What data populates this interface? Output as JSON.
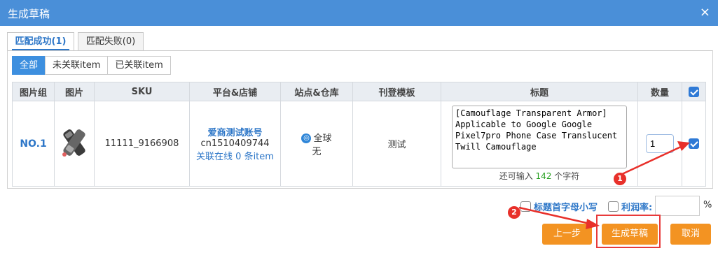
{
  "dialog": {
    "title": "生成草稿",
    "close_glyph": "×"
  },
  "tabs": [
    {
      "label": "匹配成功(1)",
      "active": true
    },
    {
      "label": "匹配失败(0)",
      "active": false
    }
  ],
  "filters": [
    {
      "label": "全部",
      "active": true
    },
    {
      "label": "未关联item",
      "active": false
    },
    {
      "label": "已关联item",
      "active": false
    }
  ],
  "table": {
    "headers": [
      "图片组",
      "图片",
      "SKU",
      "平台&店铺",
      "站点&仓库",
      "刊登模板",
      "标题",
      "数量"
    ],
    "select_all_checked": true,
    "rows": [
      {
        "group": "NO.1",
        "sku": "11111_9166908",
        "shop_name": "爱商测试账号",
        "shop_id": "cn1510409744",
        "link_text": "关联在线 0 条item",
        "site": "全球",
        "warehouse": "无",
        "template": "测试",
        "title": "[Camouflage Transparent Armor] Applicable to Google Google Pixel7pro Phone Case Translucent Twill Camouflage",
        "remaining_prefix": "还可输入",
        "remaining_count": "142",
        "remaining_suffix": "个字符",
        "quantity": "1",
        "checked": true
      }
    ]
  },
  "options": {
    "lowercase_label": "标题首字母小写",
    "profit_label": "利润率:",
    "profit_value": "",
    "percent": "%"
  },
  "buttons": {
    "prev": "上一步",
    "generate": "生成草稿",
    "cancel": "取消"
  },
  "annotations": {
    "marker1": "1",
    "marker2": "2"
  },
  "colors": {
    "header": "#4a8fd8",
    "accent": "#2e77c8",
    "button": "#f39322",
    "annotation": "#e8302a"
  }
}
